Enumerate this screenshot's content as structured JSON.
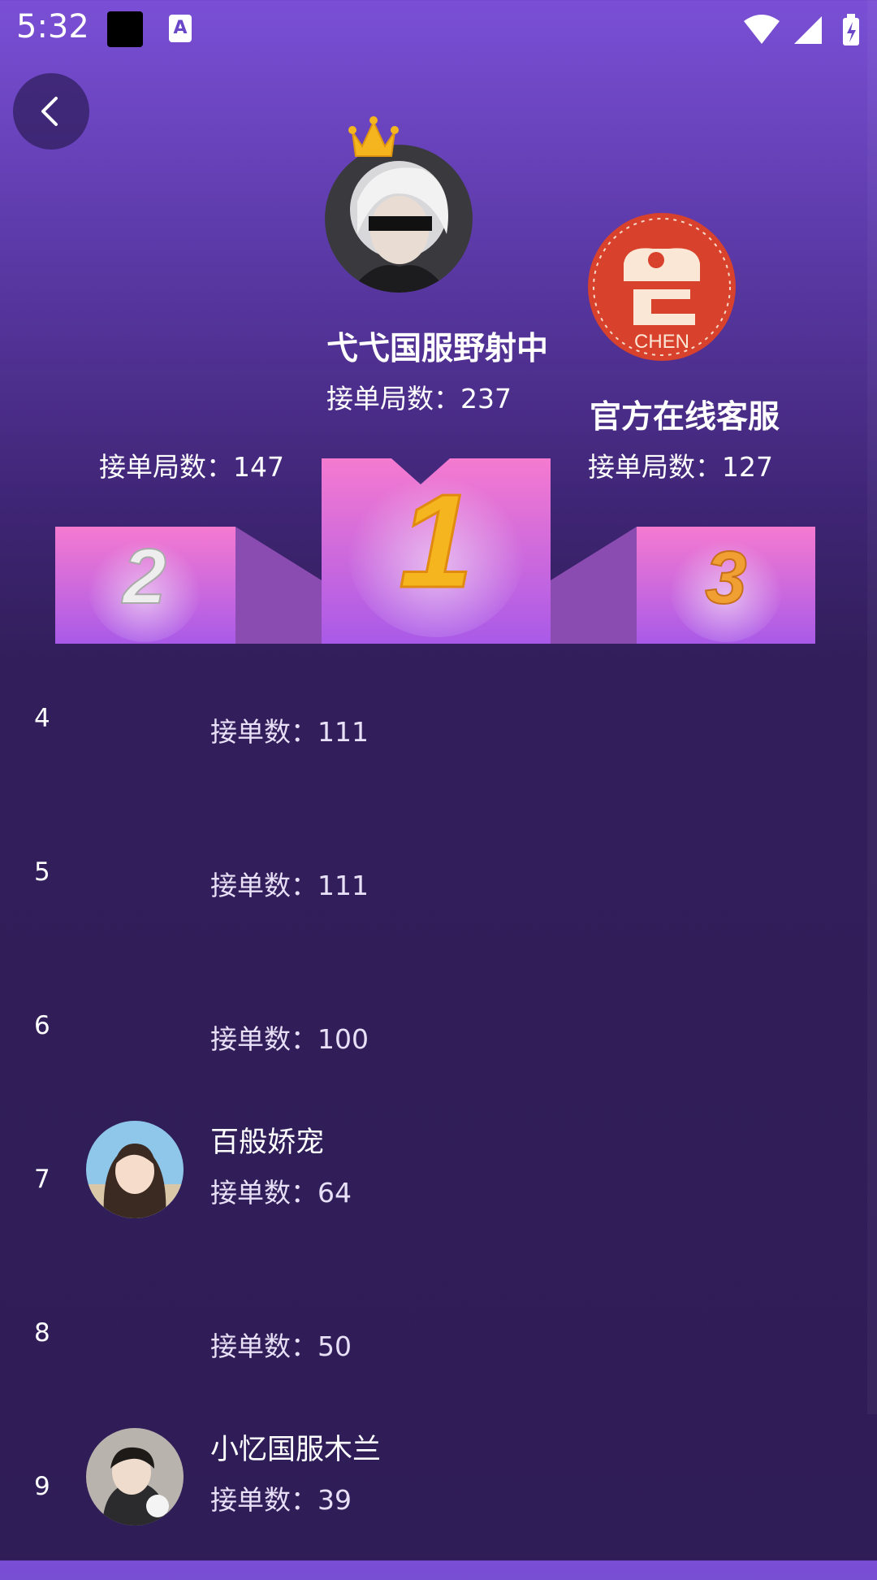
{
  "status_bar": {
    "time": "5:32",
    "app_icon_letter": "A"
  },
  "top3": {
    "first": {
      "name": "弋弋国服野射中",
      "count_text": "接单局数：237"
    },
    "second": {
      "count_text": "接单局数：147"
    },
    "third": {
      "name": "官方在线客服",
      "count_text": "接单局数：127",
      "avatar_text": "CHEN"
    }
  },
  "podium_numbers": {
    "first": "1",
    "second": "2",
    "third": "3"
  },
  "list": [
    {
      "rank": "4",
      "name": "",
      "count_text": "接单数：111"
    },
    {
      "rank": "5",
      "name": "",
      "count_text": "接单数：111"
    },
    {
      "rank": "6",
      "name": "",
      "count_text": "接单数：100"
    },
    {
      "rank": "7",
      "name": "百般娇宠",
      "count_text": "接单数：64"
    },
    {
      "rank": "8",
      "name": "",
      "count_text": "接单数：50"
    },
    {
      "rank": "9",
      "name": "小忆国服木兰",
      "count_text": "接单数：39"
    }
  ],
  "colors": {
    "background_top": "#7a4fd6",
    "background_bottom": "#2f1d58",
    "podium_pink": "#f57ad0",
    "podium_purple": "#a95ae8",
    "gold": "#f5b51e"
  }
}
